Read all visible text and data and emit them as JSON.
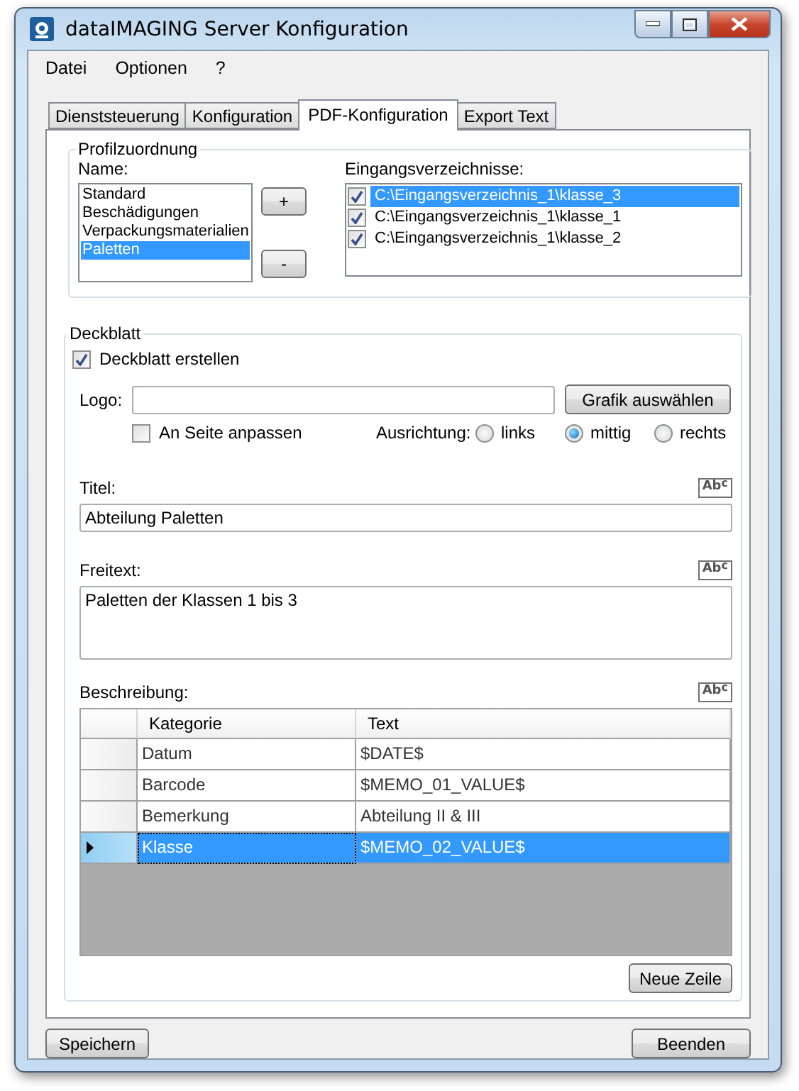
{
  "window": {
    "title": "dataIMAGING Server Konfiguration"
  },
  "menu": [
    {
      "label": "Datei"
    },
    {
      "label": "Optionen"
    },
    {
      "label": "?"
    }
  ],
  "tabs": [
    {
      "label": "Dienststeuerung",
      "selected": false
    },
    {
      "label": "Konfiguration",
      "selected": false
    },
    {
      "label": "PDF-Konfiguration",
      "selected": true
    },
    {
      "label": "Export Text",
      "selected": false
    }
  ],
  "profile": {
    "legend": "Profilzuordnung",
    "name_label": "Name:",
    "names": [
      {
        "label": "Standard",
        "selected": false
      },
      {
        "label": "Beschädigungen",
        "selected": false
      },
      {
        "label": "Verpackungsmaterialien",
        "selected": false
      },
      {
        "label": "Paletten",
        "selected": true
      }
    ],
    "add_button": "+",
    "remove_button": "-",
    "dirs_label": "Eingangsverzeichnisse:",
    "dirs": [
      {
        "path": "C:\\Eingangsverzeichnis_1\\klasse_3",
        "checked": true,
        "selected": true
      },
      {
        "path": "C:\\Eingangsverzeichnis_1\\klasse_1",
        "checked": true,
        "selected": false
      },
      {
        "path": "C:\\Eingangsverzeichnis_1\\klasse_2",
        "checked": true,
        "selected": false
      }
    ]
  },
  "cover": {
    "legend": "Deckblatt",
    "create": {
      "label": "Deckblatt erstellen",
      "checked": true
    },
    "logo_label": "Logo:",
    "choose_button": "Grafik auswählen",
    "fit": {
      "label": "An Seite anpassen",
      "checked": false
    },
    "alignment_label": "Ausrichtung:",
    "alignments": [
      {
        "label": "links",
        "selected": false
      },
      {
        "label": "mittig",
        "selected": true
      },
      {
        "label": "rechts",
        "selected": false
      }
    ],
    "title_label": "Titel:",
    "title_spell": "Ab$^{c}$",
    "title_value": "Abteilung Paletten",
    "freetext_label": "Freitext:",
    "freetext_spell": "Ab$^{c}$",
    "freetext_value": "Paletten der Klassen 1 bis 3",
    "description_label": "Beschreibung:",
    "description_spell": "Ab$^{c}$",
    "columns": [
      "Kategorie",
      "Text"
    ],
    "rows": [
      {
        "cells": [
          "Datum",
          "$DATE$"
        ],
        "selected": false
      },
      {
        "cells": [
          "Barcode",
          "$MEMO_01_VALUE$"
        ],
        "selected": false
      },
      {
        "cells": [
          "Bemerkung",
          "Abteilung II & III"
        ],
        "selected": false
      },
      {
        "cells": [
          "Klasse",
          "$MEMO_02_VALUE$"
        ],
        "selected": true
      }
    ],
    "new_row_button": "Neue Zeile"
  },
  "footer": {
    "save_button": "Speichern",
    "quit_button": "Beenden"
  }
}
